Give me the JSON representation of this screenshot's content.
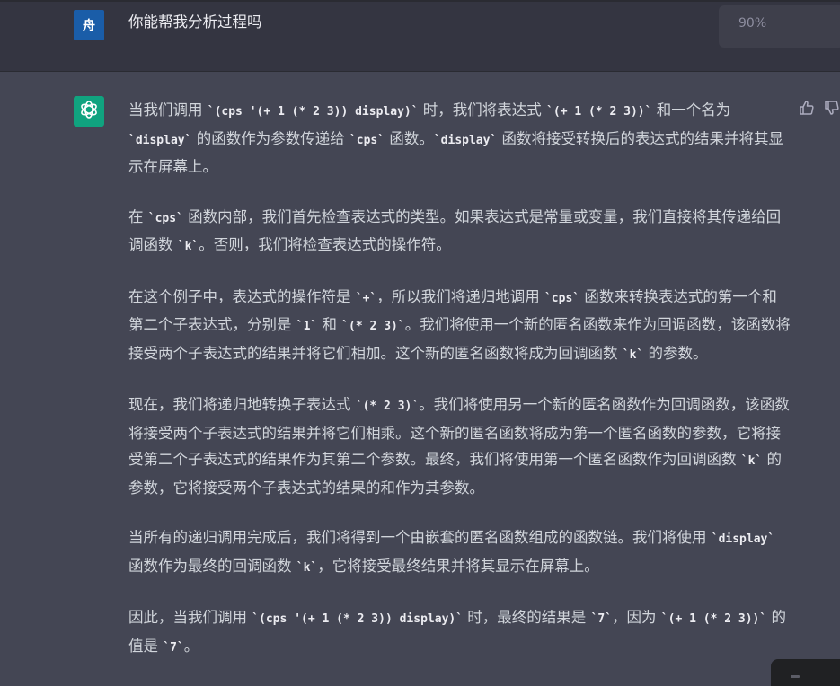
{
  "user_message": {
    "avatar_text": "舟",
    "text": "你能帮我分析过程吗"
  },
  "zoom_badge": {
    "text": "90%"
  },
  "assistant_message": {
    "paragraphs": [
      [
        {
          "t": "当我们调用 "
        },
        {
          "c": "`(cps '(+ 1 (* 2 3)) display)`"
        },
        {
          "t": " 时，我们将表达式 "
        },
        {
          "c": "`(+ 1 (* 2 3))`"
        },
        {
          "t": " 和一个名为 "
        },
        {
          "c": "`display`"
        },
        {
          "t": " 的函数作为参数传递给 "
        },
        {
          "c": "`cps`"
        },
        {
          "t": " 函数。"
        },
        {
          "c": "`display`"
        },
        {
          "t": " 函数将接受转换后的表达式的结果并将其显示在屏幕上。"
        }
      ],
      [
        {
          "t": "在 "
        },
        {
          "c": "`cps`"
        },
        {
          "t": " 函数内部，我们首先检查表达式的类型。如果表达式是常量或变量，我们直接将其传递给回调函数 "
        },
        {
          "c": "`k`"
        },
        {
          "t": "。否则，我们将检查表达式的操作符。"
        }
      ],
      [
        {
          "t": "在这个例子中，表达式的操作符是 "
        },
        {
          "c": "`+`"
        },
        {
          "t": "，所以我们将递归地调用 "
        },
        {
          "c": "`cps`"
        },
        {
          "t": " 函数来转换表达式的第一个和第二个子表达式，分别是 "
        },
        {
          "c": "`1`"
        },
        {
          "t": " 和 "
        },
        {
          "c": "`(* 2 3)`"
        },
        {
          "t": "。我们将使用一个新的匿名函数来作为回调函数，该函数将接受两个子表达式的结果并将它们相加。这个新的匿名函数将成为回调函数 "
        },
        {
          "c": "`k`"
        },
        {
          "t": " 的参数。"
        }
      ],
      [
        {
          "t": "现在，我们将递归地转换子表达式 "
        },
        {
          "c": "`(* 2 3)`"
        },
        {
          "t": "。我们将使用另一个新的匿名函数作为回调函数，该函数将接受两个子表达式的结果并将它们相乘。这个新的匿名函数将成为第一个匿名函数的参数，它将接受第二个子表达式的结果作为其第二个参数。最终，我们将使用第一个匿名函数作为回调函数 "
        },
        {
          "c": "`k`"
        },
        {
          "t": " 的参数，它将接受两个子表达式的结果的和作为其参数。"
        }
      ],
      [
        {
          "t": "当所有的递归调用完成后，我们将得到一个由嵌套的匿名函数组成的函数链。我们将使用 "
        },
        {
          "c": "`display`"
        },
        {
          "t": " 函数作为最终的回调函数 "
        },
        {
          "c": "`k`"
        },
        {
          "t": "，它将接受最终结果并将其显示在屏幕上。"
        }
      ],
      [
        {
          "t": "因此，当我们调用 "
        },
        {
          "c": "`(cps '(+ 1 (* 2 3)) display)`"
        },
        {
          "t": " 时，最终的结果是 "
        },
        {
          "c": "`7`"
        },
        {
          "t": "，因为 "
        },
        {
          "c": "`(+ 1 (* 2 3))`"
        },
        {
          "t": " 的值是 "
        },
        {
          "c": "`7`"
        },
        {
          "t": "。"
        }
      ]
    ]
  },
  "icons": [
    "thumbs-up-icon",
    "thumbs-down-icon",
    "chatgpt-logo-icon"
  ],
  "colors": {
    "user_bg": "#343541",
    "assistant_bg": "#444654",
    "gpt_avatar": "#10a37f",
    "user_avatar": "#1a5da8",
    "text": "#d1d5db"
  }
}
